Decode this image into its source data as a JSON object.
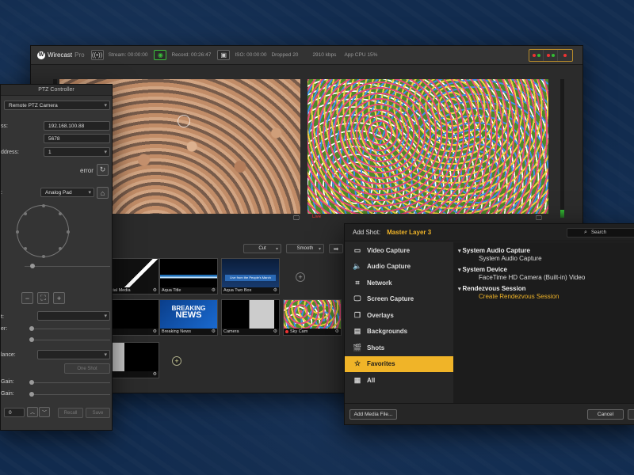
{
  "wirecast": {
    "logo_letter": "W",
    "app_name": "Wirecast",
    "app_edition": "Pro",
    "stream_label": "Stream: 00:00:00",
    "record_label": "Record: 00:26:47",
    "iso_label": "ISO: 00:00:00",
    "dropped_label": "Dropped 20",
    "bitrate_label": "2910 kbps",
    "cpu_label": "App CPU 15%",
    "live_label": "Live",
    "transition_1": "Cut",
    "transition_2": "Smooth",
    "go_glyph": "➡",
    "add_glyph": "+",
    "gear_glyph": "⚙",
    "screen_glyph": "🖵",
    "shots": [
      {
        "label": "t Social Media"
      },
      {
        "label": "Aqua Title"
      },
      {
        "label": "Aqua Two Box"
      },
      {
        "label": ""
      },
      {
        "label": "Breaking News"
      },
      {
        "label": "Camera"
      },
      {
        "label": "Sky Cam"
      },
      {
        "label": "d"
      }
    ],
    "breaking_news_thumb_text_1": "BREAKING",
    "breaking_news_thumb_text_2": "NEWS",
    "aqua_two_box_thumb_text": "Live from the People's March"
  },
  "ptz": {
    "title": "PTZ Controller",
    "camera_type": "Remote PTZ Camera",
    "label_ip": "ss:",
    "ip_value": "192.168.100.88",
    "port_value": "5678",
    "label_address": "ddress:",
    "address_value": "1",
    "error_text": "error",
    "label_control": ":",
    "control_mode": "Analog Pad",
    "label_preset": "t:",
    "label_zoom": "er:",
    "label_balance": "lance:",
    "label_gain1": "Gain:",
    "label_gain2": "Gain:",
    "one_shot": "One Shot",
    "preset_value": "0",
    "recall": "Recall",
    "save": "Save",
    "refresh_glyph": "↻",
    "home_glyph": "⌂",
    "minus_glyph": "−",
    "plus_glyph": "+",
    "up_glyph": "︿",
    "down_glyph": "﹀"
  },
  "add_shot": {
    "title": "Add Shot:",
    "layer": "Master Layer 3",
    "search_placeholder": "Search",
    "search_glyph": "⌕",
    "categories": [
      {
        "label": "Video Capture",
        "icon": "▭"
      },
      {
        "label": "Audio Capture",
        "icon": "🔈"
      },
      {
        "label": "Network",
        "icon": "⌗"
      },
      {
        "label": "Screen Capture",
        "icon": "🖵"
      },
      {
        "label": "Overlays",
        "icon": "❐"
      },
      {
        "label": "Backgrounds",
        "icon": "▤"
      },
      {
        "label": "Shots",
        "icon": "🎬"
      },
      {
        "label": "Favorites",
        "icon": "☆"
      },
      {
        "label": "All",
        "icon": "▦"
      }
    ],
    "selected_category": "Favorites",
    "groups": [
      {
        "heading": "System Audio Capture",
        "items": [
          "System Audio Capture"
        ]
      },
      {
        "heading": "System Device",
        "items": [
          "FaceTime HD Camera (Built-in) Video"
        ]
      },
      {
        "heading": "Rendezvous Session",
        "items": [
          "Create Rendezvous Session"
        ]
      }
    ],
    "add_media_button": "Add Media File...",
    "cancel_button": "Cancel"
  },
  "colors": {
    "accent": "#f0b428",
    "live_red": "#ee3333",
    "stream_green": "#3bbf3b",
    "background_blue": "#122c4f"
  }
}
